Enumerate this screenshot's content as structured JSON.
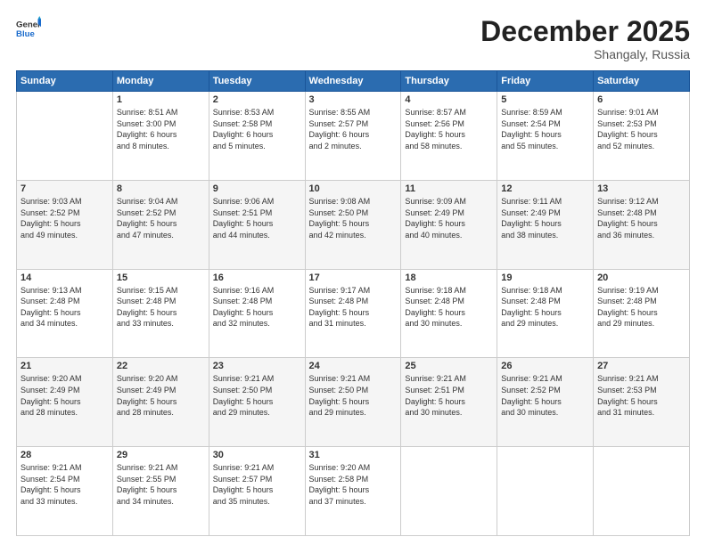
{
  "header": {
    "logo": {
      "line1": "General",
      "line2": "Blue"
    },
    "title": "December 2025",
    "location": "Shangaly, Russia"
  },
  "days_of_week": [
    "Sunday",
    "Monday",
    "Tuesday",
    "Wednesday",
    "Thursday",
    "Friday",
    "Saturday"
  ],
  "weeks": [
    [
      {
        "day": "",
        "info": ""
      },
      {
        "day": "1",
        "info": "Sunrise: 8:51 AM\nSunset: 3:00 PM\nDaylight: 6 hours\nand 8 minutes."
      },
      {
        "day": "2",
        "info": "Sunrise: 8:53 AM\nSunset: 2:58 PM\nDaylight: 6 hours\nand 5 minutes."
      },
      {
        "day": "3",
        "info": "Sunrise: 8:55 AM\nSunset: 2:57 PM\nDaylight: 6 hours\nand 2 minutes."
      },
      {
        "day": "4",
        "info": "Sunrise: 8:57 AM\nSunset: 2:56 PM\nDaylight: 5 hours\nand 58 minutes."
      },
      {
        "day": "5",
        "info": "Sunrise: 8:59 AM\nSunset: 2:54 PM\nDaylight: 5 hours\nand 55 minutes."
      },
      {
        "day": "6",
        "info": "Sunrise: 9:01 AM\nSunset: 2:53 PM\nDaylight: 5 hours\nand 52 minutes."
      }
    ],
    [
      {
        "day": "7",
        "info": "Sunrise: 9:03 AM\nSunset: 2:52 PM\nDaylight: 5 hours\nand 49 minutes."
      },
      {
        "day": "8",
        "info": "Sunrise: 9:04 AM\nSunset: 2:52 PM\nDaylight: 5 hours\nand 47 minutes."
      },
      {
        "day": "9",
        "info": "Sunrise: 9:06 AM\nSunset: 2:51 PM\nDaylight: 5 hours\nand 44 minutes."
      },
      {
        "day": "10",
        "info": "Sunrise: 9:08 AM\nSunset: 2:50 PM\nDaylight: 5 hours\nand 42 minutes."
      },
      {
        "day": "11",
        "info": "Sunrise: 9:09 AM\nSunset: 2:49 PM\nDaylight: 5 hours\nand 40 minutes."
      },
      {
        "day": "12",
        "info": "Sunrise: 9:11 AM\nSunset: 2:49 PM\nDaylight: 5 hours\nand 38 minutes."
      },
      {
        "day": "13",
        "info": "Sunrise: 9:12 AM\nSunset: 2:48 PM\nDaylight: 5 hours\nand 36 minutes."
      }
    ],
    [
      {
        "day": "14",
        "info": "Sunrise: 9:13 AM\nSunset: 2:48 PM\nDaylight: 5 hours\nand 34 minutes."
      },
      {
        "day": "15",
        "info": "Sunrise: 9:15 AM\nSunset: 2:48 PM\nDaylight: 5 hours\nand 33 minutes."
      },
      {
        "day": "16",
        "info": "Sunrise: 9:16 AM\nSunset: 2:48 PM\nDaylight: 5 hours\nand 32 minutes."
      },
      {
        "day": "17",
        "info": "Sunrise: 9:17 AM\nSunset: 2:48 PM\nDaylight: 5 hours\nand 31 minutes."
      },
      {
        "day": "18",
        "info": "Sunrise: 9:18 AM\nSunset: 2:48 PM\nDaylight: 5 hours\nand 30 minutes."
      },
      {
        "day": "19",
        "info": "Sunrise: 9:18 AM\nSunset: 2:48 PM\nDaylight: 5 hours\nand 29 minutes."
      },
      {
        "day": "20",
        "info": "Sunrise: 9:19 AM\nSunset: 2:48 PM\nDaylight: 5 hours\nand 29 minutes."
      }
    ],
    [
      {
        "day": "21",
        "info": "Sunrise: 9:20 AM\nSunset: 2:49 PM\nDaylight: 5 hours\nand 28 minutes."
      },
      {
        "day": "22",
        "info": "Sunrise: 9:20 AM\nSunset: 2:49 PM\nDaylight: 5 hours\nand 28 minutes."
      },
      {
        "day": "23",
        "info": "Sunrise: 9:21 AM\nSunset: 2:50 PM\nDaylight: 5 hours\nand 29 minutes."
      },
      {
        "day": "24",
        "info": "Sunrise: 9:21 AM\nSunset: 2:50 PM\nDaylight: 5 hours\nand 29 minutes."
      },
      {
        "day": "25",
        "info": "Sunrise: 9:21 AM\nSunset: 2:51 PM\nDaylight: 5 hours\nand 30 minutes."
      },
      {
        "day": "26",
        "info": "Sunrise: 9:21 AM\nSunset: 2:52 PM\nDaylight: 5 hours\nand 30 minutes."
      },
      {
        "day": "27",
        "info": "Sunrise: 9:21 AM\nSunset: 2:53 PM\nDaylight: 5 hours\nand 31 minutes."
      }
    ],
    [
      {
        "day": "28",
        "info": "Sunrise: 9:21 AM\nSunset: 2:54 PM\nDaylight: 5 hours\nand 33 minutes."
      },
      {
        "day": "29",
        "info": "Sunrise: 9:21 AM\nSunset: 2:55 PM\nDaylight: 5 hours\nand 34 minutes."
      },
      {
        "day": "30",
        "info": "Sunrise: 9:21 AM\nSunset: 2:57 PM\nDaylight: 5 hours\nand 35 minutes."
      },
      {
        "day": "31",
        "info": "Sunrise: 9:20 AM\nSunset: 2:58 PM\nDaylight: 5 hours\nand 37 minutes."
      },
      {
        "day": "",
        "info": ""
      },
      {
        "day": "",
        "info": ""
      },
      {
        "day": "",
        "info": ""
      }
    ]
  ]
}
